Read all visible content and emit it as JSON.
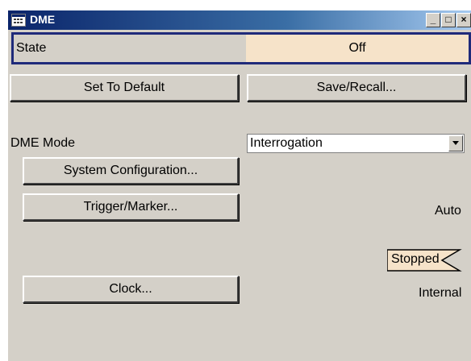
{
  "window": {
    "title": "DME",
    "min_label": "_",
    "max_label": "□",
    "close_label": "×"
  },
  "state": {
    "label": "State",
    "value": "Off"
  },
  "buttons": {
    "set_default": "Set To Default",
    "save_recall": "Save/Recall...",
    "system_config": "System Configuration...",
    "trigger_marker": "Trigger/Marker...",
    "clock": "Clock..."
  },
  "dme_mode": {
    "label": "DME Mode",
    "value": "Interrogation"
  },
  "trigger": {
    "mode": "Auto",
    "status": "Stopped"
  },
  "clock": {
    "source": "Internal"
  },
  "colors": {
    "panel": "#d4d0c8",
    "state_highlight": "#f6e3c9",
    "focus_border": "#1f2a7a",
    "title_gradient_start": "#0a246a"
  }
}
